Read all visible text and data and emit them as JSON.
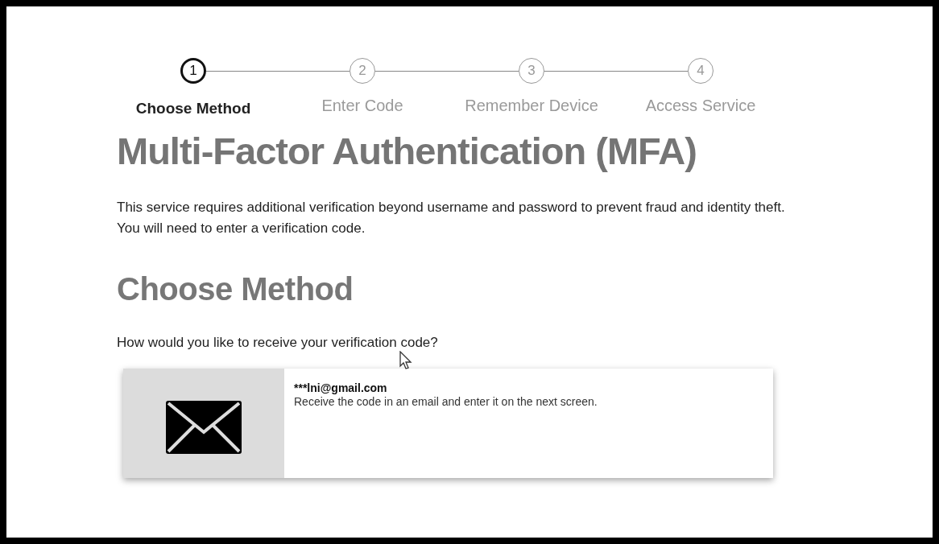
{
  "steps": [
    {
      "number": "1",
      "label": "Choose Method",
      "selected": true
    },
    {
      "number": "2",
      "label": "Enter Code",
      "selected": false
    },
    {
      "number": "3",
      "label": "Remember Device",
      "selected": false
    },
    {
      "number": "4",
      "label": "Access Service",
      "selected": false
    }
  ],
  "title": "Multi-Factor Authentication (MFA)",
  "intro": "This service requires additional verification beyond username and password to prevent fraud and identity theft. You will need to enter a verification code.",
  "section_title": "Choose Method",
  "question": "How would you like to receive your verification code?",
  "methods": [
    {
      "kind": "email",
      "address": "***lni@gmail.com",
      "description": "Receive the code in an email and enter it on the next screen."
    }
  ]
}
